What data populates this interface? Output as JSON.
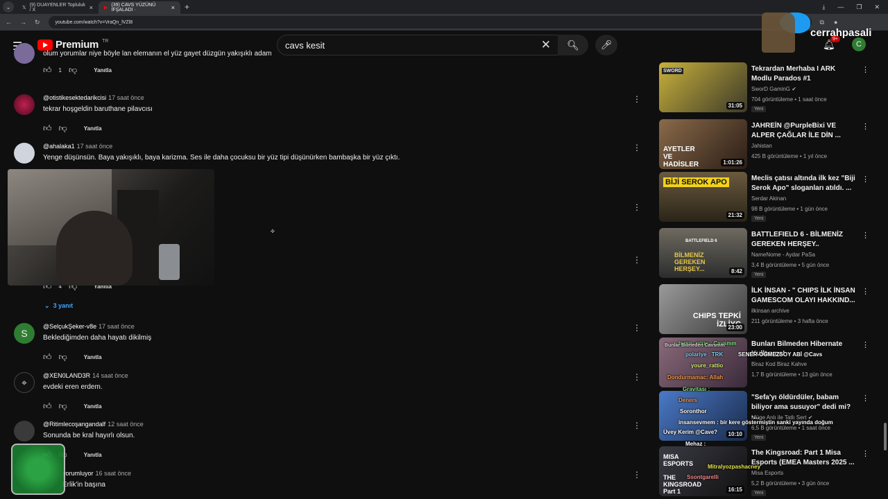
{
  "browser": {
    "tabs": [
      {
        "label": "(9) DUAYENLER Topluluk / X",
        "active": false
      },
      {
        "label": "(39) CAVS YÜZÜNÜ İFŞALADI ·",
        "active": true
      }
    ],
    "url": "youtube.com/watch?v=VraQn_lVZl8"
  },
  "header": {
    "logo_text": "Premium",
    "region": "TR",
    "search_value": "cavs kesit",
    "notifications": "9+",
    "avatar_letter": "C"
  },
  "overlay": {
    "handle": "cerrahpasali"
  },
  "comments": [
    {
      "author": "",
      "time": "",
      "text": "olum yorumlar niye böyle lan elemanın el yüz gayet düzgün yakışıklı adam",
      "likes": "1",
      "reply": "Yanıtla",
      "avatar_color": "#7a6b9b"
    },
    {
      "author": "@otistikesektedarikcisi",
      "time": "17 saat önce",
      "text": "tekrar hoşgeldin baruthane pilavcısı",
      "likes": "",
      "reply": "Yanıtla",
      "avatar_color": "#8b1a3a"
    },
    {
      "author": "@ahalaka1",
      "time": "17 saat önce",
      "text": "Yenge düşünsün. Baya yakışıklı, baya karizma. Ses ile daha çocuksu bir yüz tipi düşünürken bambaşka bir yüz çıktı.",
      "likes": "4",
      "reply": "Yanıtla",
      "avatar_color": "#d0d4dc"
    },
    {
      "author": "@SelçukŞeker-v8e",
      "time": "17 saat önce",
      "text": "Beklediğimden daha hayatı dikilmiş",
      "likes": "",
      "reply": "Yanıtla",
      "avatar_color": "#2e7d32",
      "initial": "S"
    },
    {
      "author": "@XEN0LAND3R",
      "time": "14 saat önce",
      "text": "evdeki eren erdem.",
      "likes": "",
      "reply": "Yanıtla",
      "avatar_color": "#111111"
    },
    {
      "author": "@Ritimlecoşangandalf",
      "time": "12 saat önce",
      "text": "Sonunda be kral hayırlı olsun.",
      "likes": "",
      "reply": "Yanıtla",
      "avatar_color": "#3a3a3a"
    },
    {
      "author": "yorumluyor",
      "time": "16 saat önce",
      "text": "Erlik'in başına",
      "likes": "",
      "reply": "",
      "avatar_color": "#444444"
    }
  ],
  "replies_toggle": "3 yanıt",
  "sidebar": [
    {
      "title": "Tekrardan Merhaba  I  ARK Modlu Parados #1",
      "channel": "SworD GaminG",
      "meta": "704 görüntüleme • 1 saat önce",
      "duration": "31:05",
      "new": "Yeni",
      "thumb": "#3d3a2a"
    },
    {
      "title": "JAHREİN @PurpleBixi VE ALPER ÇAĞLAR İLE DİN ...",
      "channel": "Jahistan",
      "meta": "425 B görüntüleme • 1 yıl önce",
      "duration": "1:01:26",
      "new": "",
      "thumb": "#4a3526"
    },
    {
      "title": "Meclis çatısı altında ilk kez \"Biji Serok Apo\" sloganları atıldı. ...",
      "channel": "Serdar Akinan",
      "meta": "98 B görüntüleme • 1 gün önce",
      "duration": "21:32",
      "new": "Yeni",
      "thumb": "#5a4a2e"
    },
    {
      "title": "BATTLEFIELD 6 - BİLMENİZ GEREKEN HERŞEY..",
      "channel": "NameNome - Aydar PaSa",
      "meta": "3,4 B görüntüleme • 5 gün önce",
      "duration": "8:42",
      "new": "Yeni",
      "thumb": "#3a4040"
    },
    {
      "title": "İLK İNSAN - \" CHIPS İLK İNSAN GAMESCOM OLAYI HAKKIND...",
      "channel": "ilkinsan archive",
      "meta": "211 görüntüleme • 3 hafta önce",
      "duration": "23:00",
      "new": "",
      "thumb": "#585858"
    },
    {
      "title": "Bunları Bilmeden Hibernate Kullanma!",
      "channel": "Biraz Kod Biraz Kahve",
      "meta": "1,7 B görüntüleme • 13 gün önce",
      "duration": "",
      "new": "",
      "thumb": "#6a4a5a"
    },
    {
      "title": "\"Sefa'yı öldürdüler, babam biliyor ama susuyor\" dedi mi? -...",
      "channel": "Müge Anlı ile Tatlı Sert",
      "meta": "6,5 B görüntüleme • 1 saat önce",
      "duration": "10:10",
      "new": "Yeni",
      "thumb": "#2a4a7a"
    },
    {
      "title": "The Kingsroad: Part 1 Misa Esports (EMEA Masters 2025 ...",
      "channel": "Misa Esports",
      "meta": "5,2 B görüntüleme • 3 gün önce",
      "duration": "16:15",
      "new": "Yeni",
      "thumb": "#222228"
    }
  ],
  "thumb_text": {
    "sword": "SWORD",
    "ayetler": "AYETLER VE HADİSLER",
    "biji": "BİJİ SEROK APO",
    "bf": "BİLMENİZ GEREKEN HERŞEY...",
    "bf_top": "BATTLEFIELD 6",
    "chips": "CHIPS TEPKİ İZLİYC",
    "misa": "MISA ESPORTS",
    "kingsroad": "THE KINGSROAD Part 1"
  },
  "chat_overlay": [
    {
      "text": "tnrsn_ucus : Cavsmm"
    },
    {
      "text": "SENER-OĞMEZSOY ABİ @Cavs"
    },
    {
      "text": "youre_rattio"
    },
    {
      "text": "Dondurmamac: Allah"
    },
    {
      "text": "Gravitası :"
    },
    {
      "text": "insansevmem : bir kere göstermiştin sanki yayında doğum"
    },
    {
      "text": "Üvey Kerim @Cave?"
    },
    {
      "text": "Mehaz :"
    },
    {
      "text": "Mitralyozpashacney"
    },
    {
      "text": "Ssontgarelli"
    },
    {
      "text": "Deners"
    },
    {
      "text": "Soronthor"
    },
    {
      "text": "polariye : TRK"
    },
    {
      "text": "Bunlar Bilmeden Cavsmm"
    }
  ]
}
